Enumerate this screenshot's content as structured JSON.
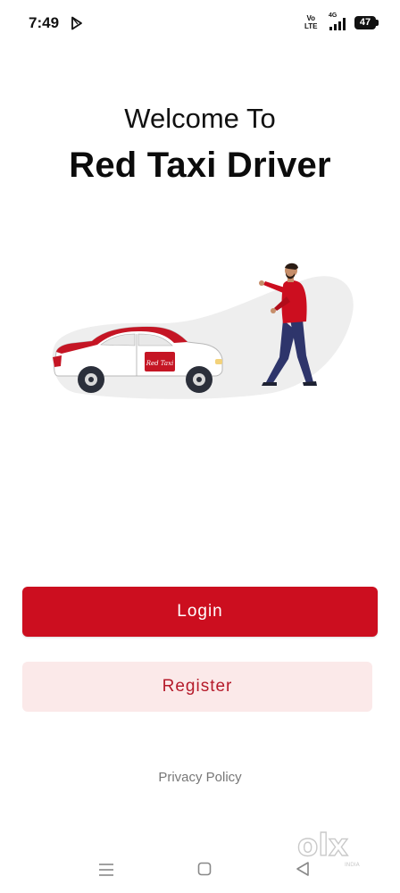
{
  "status_bar": {
    "time": "7:49",
    "volte_top": "Vo",
    "volte_bottom": "LTE",
    "network": "4G",
    "battery": "47",
    "icons": [
      "play-store-icon",
      "signal-icon",
      "battery-icon"
    ]
  },
  "welcome": {
    "line1": "Welcome To",
    "title": "Red Taxi Driver"
  },
  "illustration": {
    "taxi_logo": "Red Taxi",
    "icons": [
      "taxi-icon",
      "hailing-person-icon"
    ]
  },
  "actions": {
    "login_label": "Login",
    "register_label": "Register",
    "privacy_label": "Privacy Policy"
  },
  "watermark": {
    "text": "olx",
    "sub": "INDIA"
  },
  "nav": {
    "icons": [
      "menu-icon",
      "home-icon",
      "back-icon"
    ]
  },
  "colors": {
    "primary": "#cc0e1f",
    "register_bg": "#fbe9e9",
    "register_text": "#b51a2a"
  }
}
